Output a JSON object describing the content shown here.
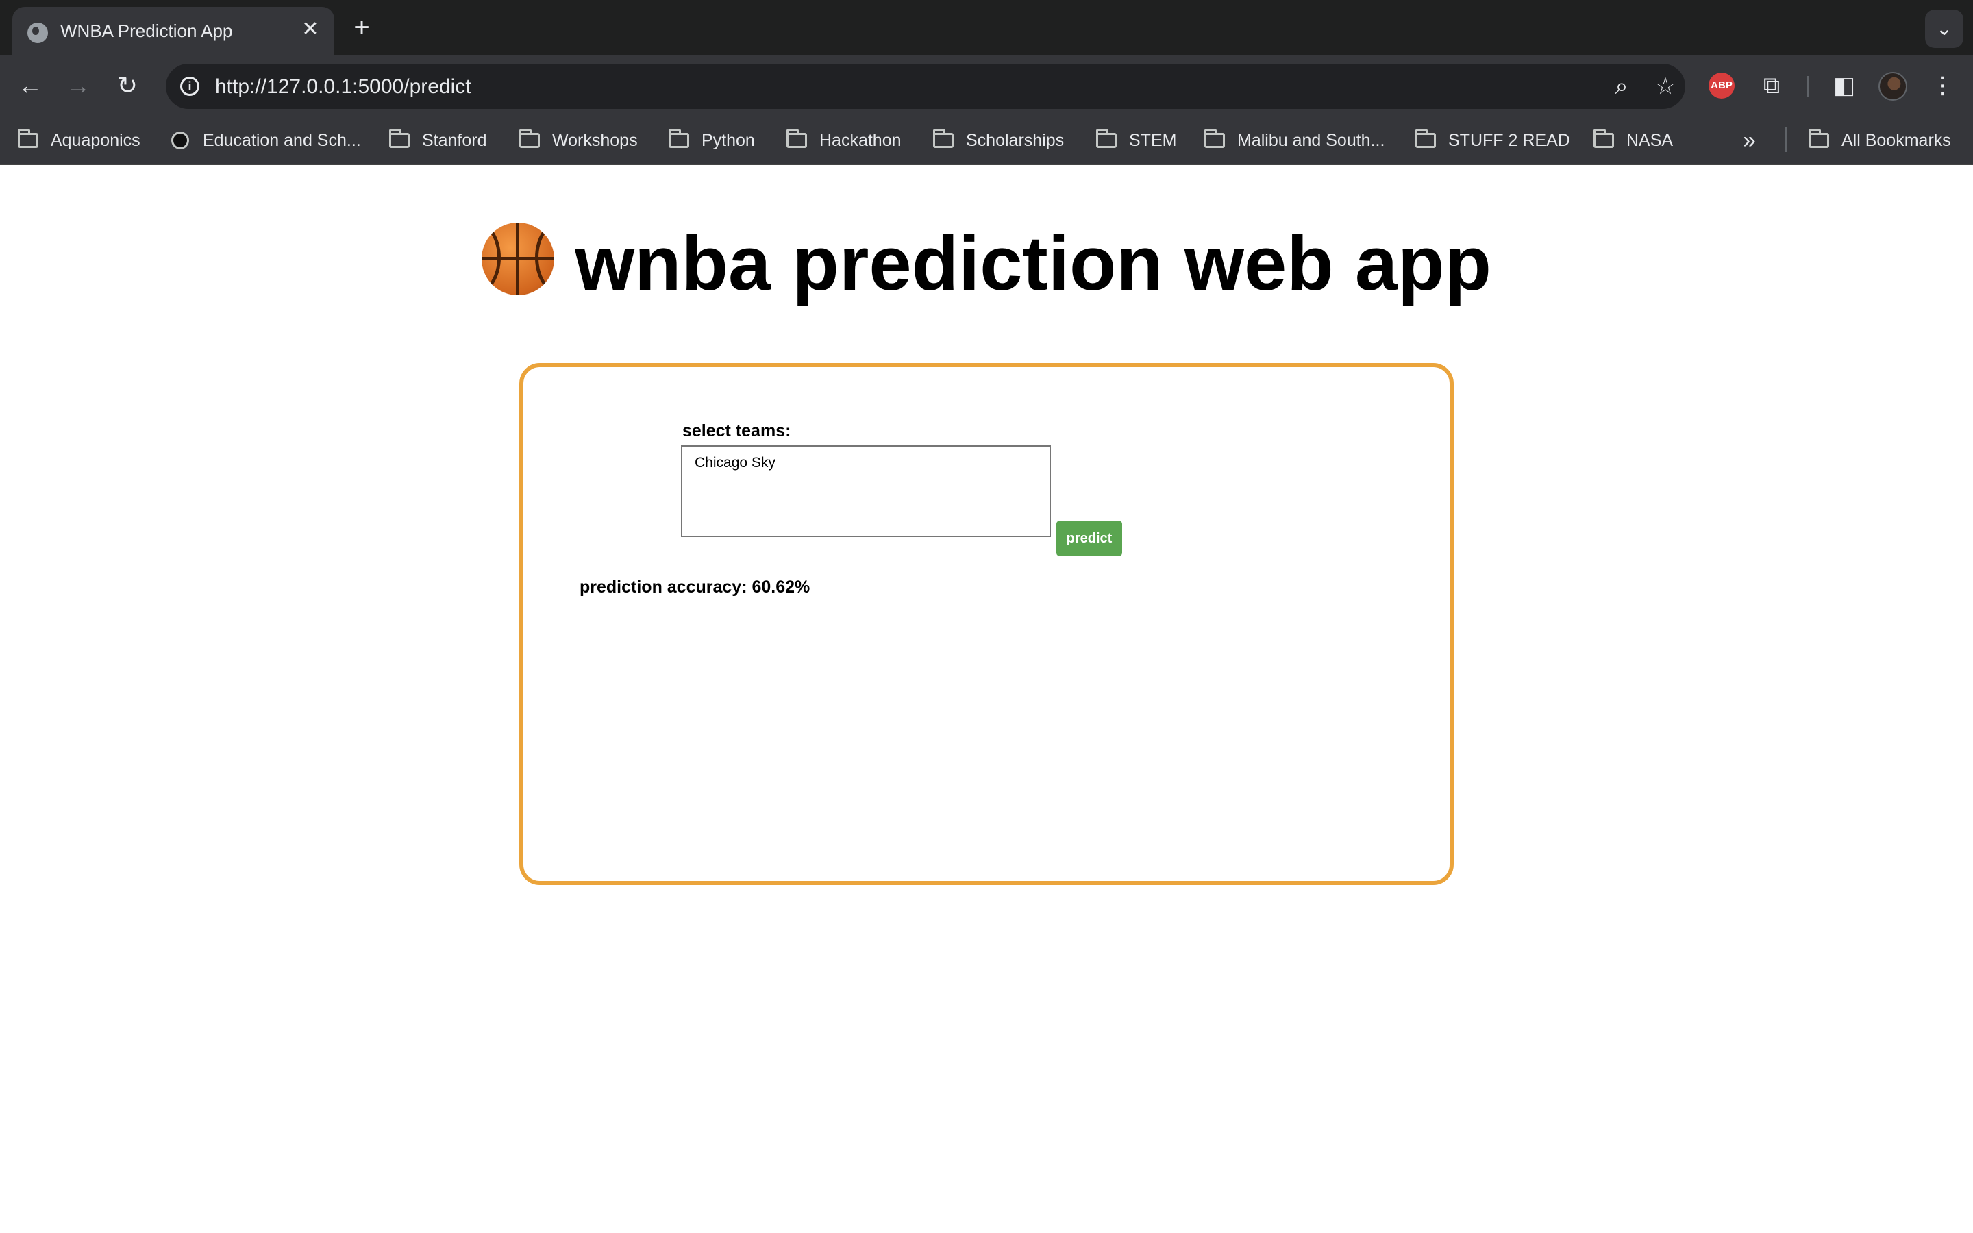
{
  "browser": {
    "tab_title": "WNBA Prediction App",
    "tab_close": "✕",
    "new_tab": "+",
    "tab_menu": "⌄",
    "url": "http://127.0.0.1:5000/predict",
    "extension_abp": "ABP",
    "bookmarks": [
      "Aquaponics",
      "Education and Sch...",
      "Stanford",
      "Workshops",
      "Python",
      "Hackathon",
      "Scholarships",
      "STEM",
      "Malibu and South...",
      "STUFF 2 READ",
      "NASA"
    ],
    "all_bookmarks": "All Bookmarks"
  },
  "page": {
    "title": "wnba prediction web app",
    "select_label": "select teams:",
    "select_options": [
      "Chicago Sky"
    ],
    "predict_label": "predict",
    "accuracy": "prediction accuracy: 60.62%"
  },
  "colors": {
    "card_border": "#eba43b",
    "predict_button": "#5aa550",
    "chrome_dark": "#1f2020",
    "chrome_toolbar": "#35363a"
  },
  "icons": [
    "globe-icon",
    "back-arrow-icon",
    "forward-arrow-icon",
    "reload-icon",
    "site-info-icon",
    "zoom-icon",
    "bookmark-star-icon",
    "adblock-icon",
    "extensions-icon",
    "side-panel-icon",
    "more-menu-icon",
    "folder-icon",
    "basketball-icon"
  ]
}
